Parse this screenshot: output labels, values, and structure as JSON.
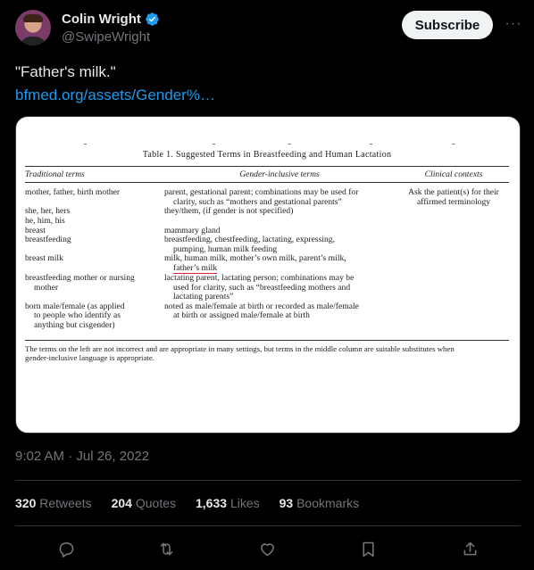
{
  "author": {
    "name": "Colin Wright",
    "handle": "@SwipeWright",
    "verified": true
  },
  "subscribe_label": "Subscribe",
  "more_label": "···",
  "tweet": {
    "text": "\"Father's milk.\"",
    "link_text": "bfmed.org/assets/Gender%…"
  },
  "document": {
    "title": "Table 1. Suggested Terms in Breastfeeding and Human Lactation",
    "headers": {
      "traditional": "Traditional terms",
      "inclusive": "Gender-inclusive terms",
      "clinical": "Clinical contexts"
    },
    "rows": [
      {
        "traditional": [
          "mother, father, birth mother"
        ],
        "inclusive": [
          "parent, gestational parent; combinations may be used for",
          "clarity, such as “mothers and gestational parents”"
        ],
        "clinical": [
          "Ask the patient(s) for their",
          "affirmed terminology"
        ]
      },
      {
        "traditional": [
          "she, her, hers",
          "he, him, his"
        ],
        "inclusive": [
          "they/them, (if gender is not specified)"
        ],
        "clinical": []
      },
      {
        "traditional": [
          "breast"
        ],
        "inclusive": [
          "mammary gland"
        ],
        "clinical": []
      },
      {
        "traditional": [
          "breastfeeding"
        ],
        "inclusive": [
          "breastfeeding, chestfeeding, lactating, expressing,",
          "pumping, human milk feeding"
        ],
        "clinical": []
      },
      {
        "traditional": [
          "breast milk"
        ],
        "inclusive": [
          "milk, human milk, mother’s own milk, parent’s milk,",
          "father’s milk"
        ],
        "clinical": []
      },
      {
        "traditional": [
          "breastfeeding mother or nursing",
          "mother"
        ],
        "inclusive": [
          "lactating parent, lactating person; combinations may be",
          "used for clarity, such as “breastfeeding mothers and",
          "lactating parents”"
        ],
        "clinical": []
      },
      {
        "traditional": [
          "born male/female (as applied",
          "to people who identify as",
          "anything but cisgender)"
        ],
        "inclusive": [
          "noted as male/female at birth or recorded as male/female",
          "at birth or assigned male/female at birth"
        ],
        "clinical": []
      }
    ],
    "footnote": [
      "The terms on the left are not incorrect and are appropriate in many settings, but terms in the middle column are suitable substitutes when",
      "gender-inclusive language is appropriate."
    ]
  },
  "timestamp": "9:02 AM · Jul 26, 2022",
  "stats": {
    "retweets_count": "320",
    "retweets_label": "Retweets",
    "quotes_count": "204",
    "quotes_label": "Quotes",
    "likes_count": "1,633",
    "likes_label": "Likes",
    "bookmarks_count": "93",
    "bookmarks_label": "Bookmarks"
  },
  "actions": {
    "reply_icon": "reply-icon",
    "retweet_icon": "retweet-icon",
    "like_icon": "heart-icon",
    "bookmark_icon": "bookmark-icon",
    "share_icon": "share-icon"
  },
  "colors": {
    "background": "#000000",
    "text": "#e7e9ea",
    "muted": "#71767b",
    "link": "#1d9bf0",
    "verified": "#1d9bf0",
    "highlight_underline": "#d3243a"
  }
}
